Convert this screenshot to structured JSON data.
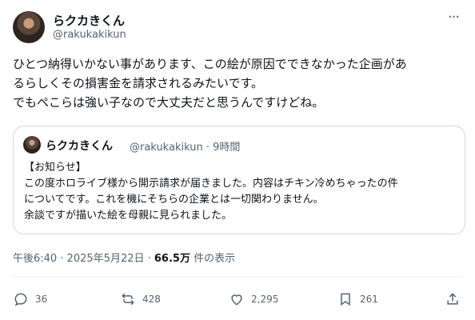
{
  "author": {
    "name": "らクカきくん",
    "handle": "@rakukakikun"
  },
  "tweet": {
    "lines": [
      "ひとつ納得いかない事があります、この絵が原因でできなかった企画があ",
      "るらしくその損害金を請求されるみたいです。",
      "でもぺこらは強い子なので大丈夫だと思うんですけどね。"
    ]
  },
  "quote": {
    "name": "らクカきくん",
    "meta": "@rakukakikun · 9時間",
    "lines": [
      "【お知らせ】",
      "この度ホロライブ様から開示請求が届きました。内容はチキン冷めちゃったの件",
      "についてです。これを機にそちらの企業とは一切関わりません。",
      "余談ですが描いた絵を母親に見られました。"
    ]
  },
  "timestamp": {
    "time": "午後6:40 · 2025年5月22日 · ",
    "views": "66.5万",
    "views_suffix": " 件の表示"
  },
  "actions": {
    "replies": "36",
    "reposts": "428",
    "likes": "2,295",
    "bookmarks": "261"
  }
}
